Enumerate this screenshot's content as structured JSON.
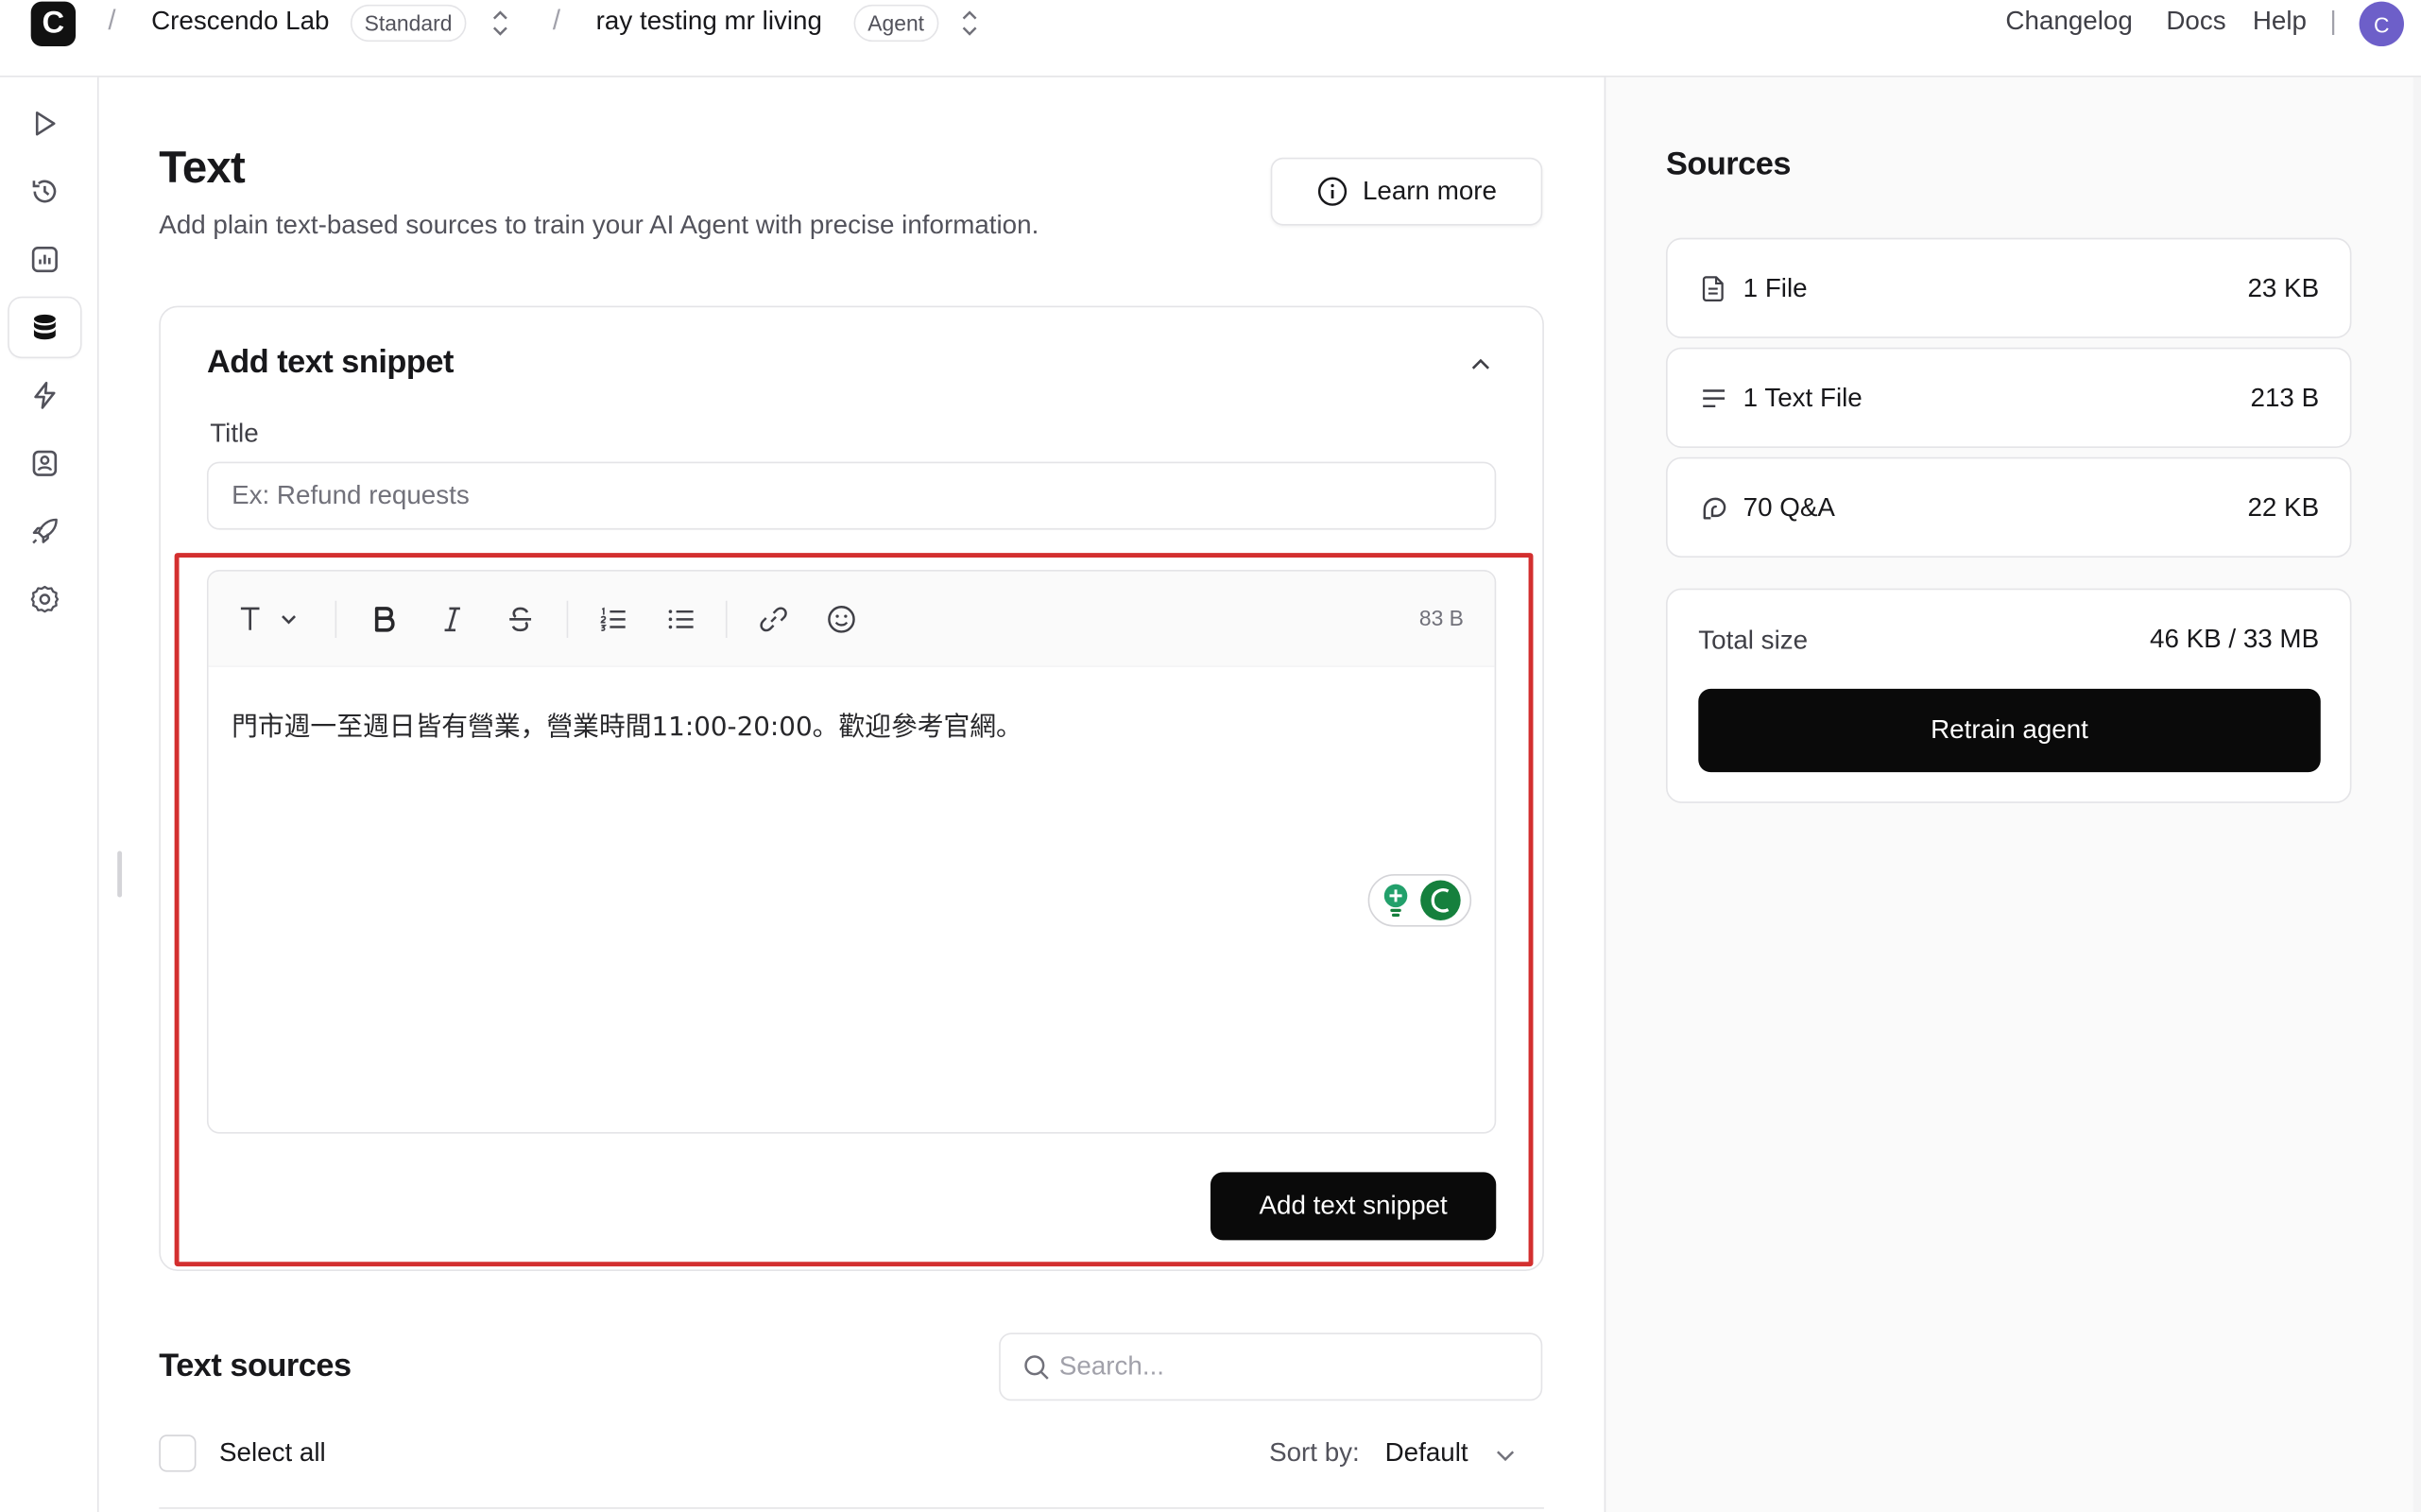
{
  "header": {
    "logo_letter": "C",
    "separator": "/",
    "workspace": "Crescendo Lab",
    "plan_badge": "Standard",
    "agent_name": "ray testing mr living",
    "agent_badge": "Agent",
    "links": [
      "Changelog",
      "Docs",
      "Help"
    ],
    "divider": "|",
    "avatar_letter": "C"
  },
  "rail": {
    "icons": [
      "play-icon",
      "history-icon",
      "analytics-icon",
      "database-icon",
      "actions-icon",
      "contacts-icon",
      "deploy-icon",
      "settings-icon"
    ],
    "active_index": 3
  },
  "main": {
    "title": "Text",
    "description": "Add plain text-based sources to train your AI Agent with precise information.",
    "learn_more": "Learn more",
    "snippet_card": {
      "title": "Add text snippet",
      "field_label": "Title",
      "title_placeholder": "Ex: Refund requests",
      "title_value": "",
      "size_label": "83 B",
      "editor_text": "門市週一至週日皆有營業，營業時間11:00-20:00。歡迎參考官網。",
      "toolbar": [
        "text-style-icon",
        "bold-icon",
        "italic-icon",
        "strikethrough-icon",
        "ordered-list-icon",
        "bullet-list-icon",
        "link-icon",
        "emoji-icon"
      ],
      "submit_label": "Add text snippet"
    },
    "text_sources": {
      "title": "Text sources",
      "search_placeholder": "Search...",
      "select_all": "Select all",
      "sort_label": "Sort by:",
      "sort_value": "Default"
    }
  },
  "sources_panel": {
    "title": "Sources",
    "items": [
      {
        "label": "1 File",
        "size": "23 KB",
        "icon": "file-icon"
      },
      {
        "label": "1 Text File",
        "size": "213 B",
        "icon": "text-lines-icon"
      },
      {
        "label": "70 Q&A",
        "size": "22 KB",
        "icon": "qa-icon"
      }
    ],
    "total_label": "Total size",
    "total_value": "46 KB / 33 MB",
    "retrain_label": "Retrain agent"
  },
  "colors": {
    "accent_dark": "#0a0a0a",
    "highlight_border": "#d32f2f",
    "avatar": "#6d5fc9",
    "grammar_green": "#15803d"
  }
}
